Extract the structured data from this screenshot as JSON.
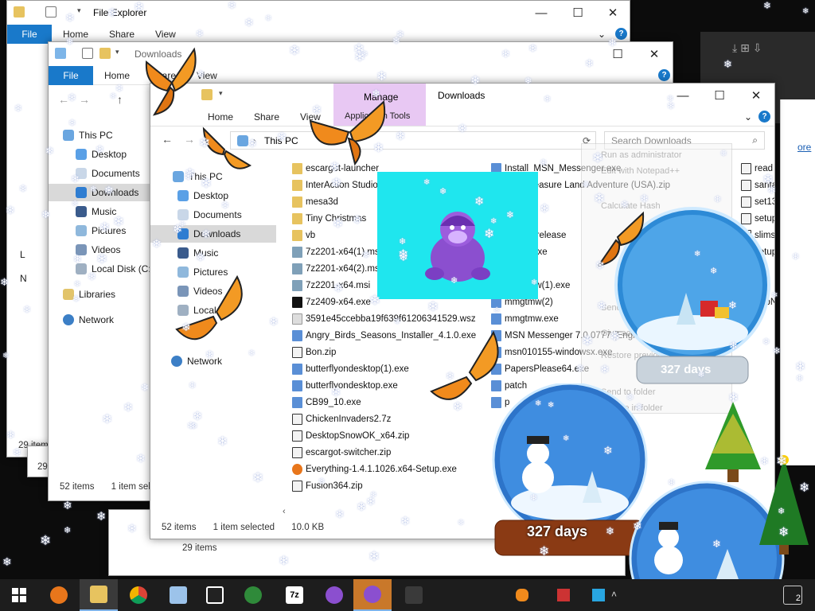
{
  "windows": {
    "back": {
      "title": "File Explorer",
      "ribbon": {
        "file": "File",
        "tabs": [
          "Home",
          "Share",
          "View"
        ]
      },
      "status": {
        "items": "29 items"
      },
      "nav_letters": [
        "L",
        "N"
      ]
    },
    "middle": {
      "title": "Downloads",
      "ribbon": {
        "file": "File",
        "tabs": [
          "Home",
          "Share",
          "View"
        ]
      },
      "nav": [
        "This PC",
        "Desktop",
        "Documents",
        "Downloads",
        "Music",
        "Pictures",
        "Videos",
        "Local Disk (C:)",
        "Libraries",
        "Network"
      ],
      "status": {
        "items": "52 items",
        "selected": "1 item sel"
      }
    },
    "front": {
      "title": "Downloads",
      "manage_tab": "Manage",
      "ribbon": {
        "file": "File",
        "tabs": [
          "Home",
          "Share",
          "View"
        ],
        "app_tools": "Application Tools"
      },
      "address": "This PC",
      "search_placeholder": "Search Downloads",
      "nav": [
        "This PC",
        "Desktop",
        "Documents",
        "Downloads",
        "Music",
        "Pictures",
        "Videos",
        "Local",
        "Network"
      ],
      "status": {
        "items": "52 items",
        "selected": "1 item selected",
        "size": "10.0 KB"
      },
      "files_col1": [
        {
          "name": "escargot-launcher",
          "type": "folder"
        },
        {
          "name": "InterAction Studio",
          "type": "folder"
        },
        {
          "name": "mesa3d",
          "type": "folder"
        },
        {
          "name": "Tiny Christmas",
          "type": "folder"
        },
        {
          "name": "vb",
          "type": "folder"
        },
        {
          "name": "7z2201-x64(1).msi",
          "type": "msi"
        },
        {
          "name": "7z2201-x64(2).msi",
          "type": "msi"
        },
        {
          "name": "7z2201-x64.msi",
          "type": "msi"
        },
        {
          "name": "7z2409-x64.exe",
          "type": "7z"
        },
        {
          "name": "3591e45ccebba19f639f61206341529.wsz",
          "type": "wsz"
        },
        {
          "name": "Angry_Birds_Seasons_Installer_4.1.0.exe",
          "type": "exe"
        },
        {
          "name": "Bon.zip",
          "type": "zip"
        },
        {
          "name": "butterflyondesktop(1).exe",
          "type": "exe"
        },
        {
          "name": "butterflyondesktop.exe",
          "type": "exe"
        },
        {
          "name": "CB99_10.exe",
          "type": "exe"
        },
        {
          "name": "ChickenInvaders2.7z",
          "type": "zip"
        },
        {
          "name": "DesktopSnowOK_x64.zip",
          "type": "zip"
        },
        {
          "name": "escargot-switcher.zip",
          "type": "zip"
        },
        {
          "name": "Everything-1.4.1.1026.x64-Setup.exe",
          "type": "ff"
        },
        {
          "name": "Fusion364.zip",
          "type": "zip"
        }
      ],
      "files_col2": [
        {
          "name": "Install_MSN_Messenger.exe",
          "type": "exe"
        },
        {
          "name": "ald's Treasure Land Adventure (USA).zip",
          "type": "zip"
        },
        {
          "name": "1).exe",
          "type": "exe",
          "selected": true
        },
        {
          "name": "exe",
          "type": "exe"
        },
        {
          "name": "-24.3.1-release",
          "type": "exe"
        },
        {
          "name": "ow (1).exe",
          "type": "exe"
        },
        {
          "name": "w(1)",
          "type": "exe"
        },
        {
          "name": "mmgtmw(1).exe",
          "type": "exe"
        },
        {
          "name": "mmgtmw(2)",
          "type": "exe"
        },
        {
          "name": "mmgtmw.exe",
          "type": "exe"
        },
        {
          "name": "MSN Messenger 7.0.0777 (English)",
          "type": "exe"
        },
        {
          "name": "msn010155-windowsx.exe",
          "type": "exe"
        },
        {
          "name": "PapersPlease64.exe",
          "type": "exe"
        },
        {
          "name": "patch",
          "type": "exe"
        },
        {
          "name": "p",
          "type": "exe"
        }
      ],
      "files_col3": [
        "read",
        "santa",
        "set13",
        "setup",
        "slims",
        "setup",
        "win",
        "wpt",
        "ZapN"
      ]
    },
    "lower": {
      "status": {
        "items": "29 items"
      }
    }
  },
  "context_menu": [
    "Run as administrator",
    "Edit with Notepad++",
    "Calculate Hash",
    "Send to",
    "Give access to",
    "Restore previous versions",
    "Send to folder",
    "Include in folder"
  ],
  "overlays": {
    "globe_days_1": "327 days",
    "globe_days_2": "327 days",
    "right_edge_text": "ore"
  },
  "taskbar": {
    "apps": [
      "start-button",
      "firefox",
      "file-explorer",
      "chrome",
      "computer",
      "security",
      "game",
      "7zip",
      "bonzi",
      "bonzi-active",
      "blank"
    ],
    "tray_count": "2"
  },
  "colors": {
    "accent": "#1979ca",
    "selection": "#cce8ff",
    "manage_tab": "#e8c8f3",
    "taskbar": "#1d1d1d"
  }
}
